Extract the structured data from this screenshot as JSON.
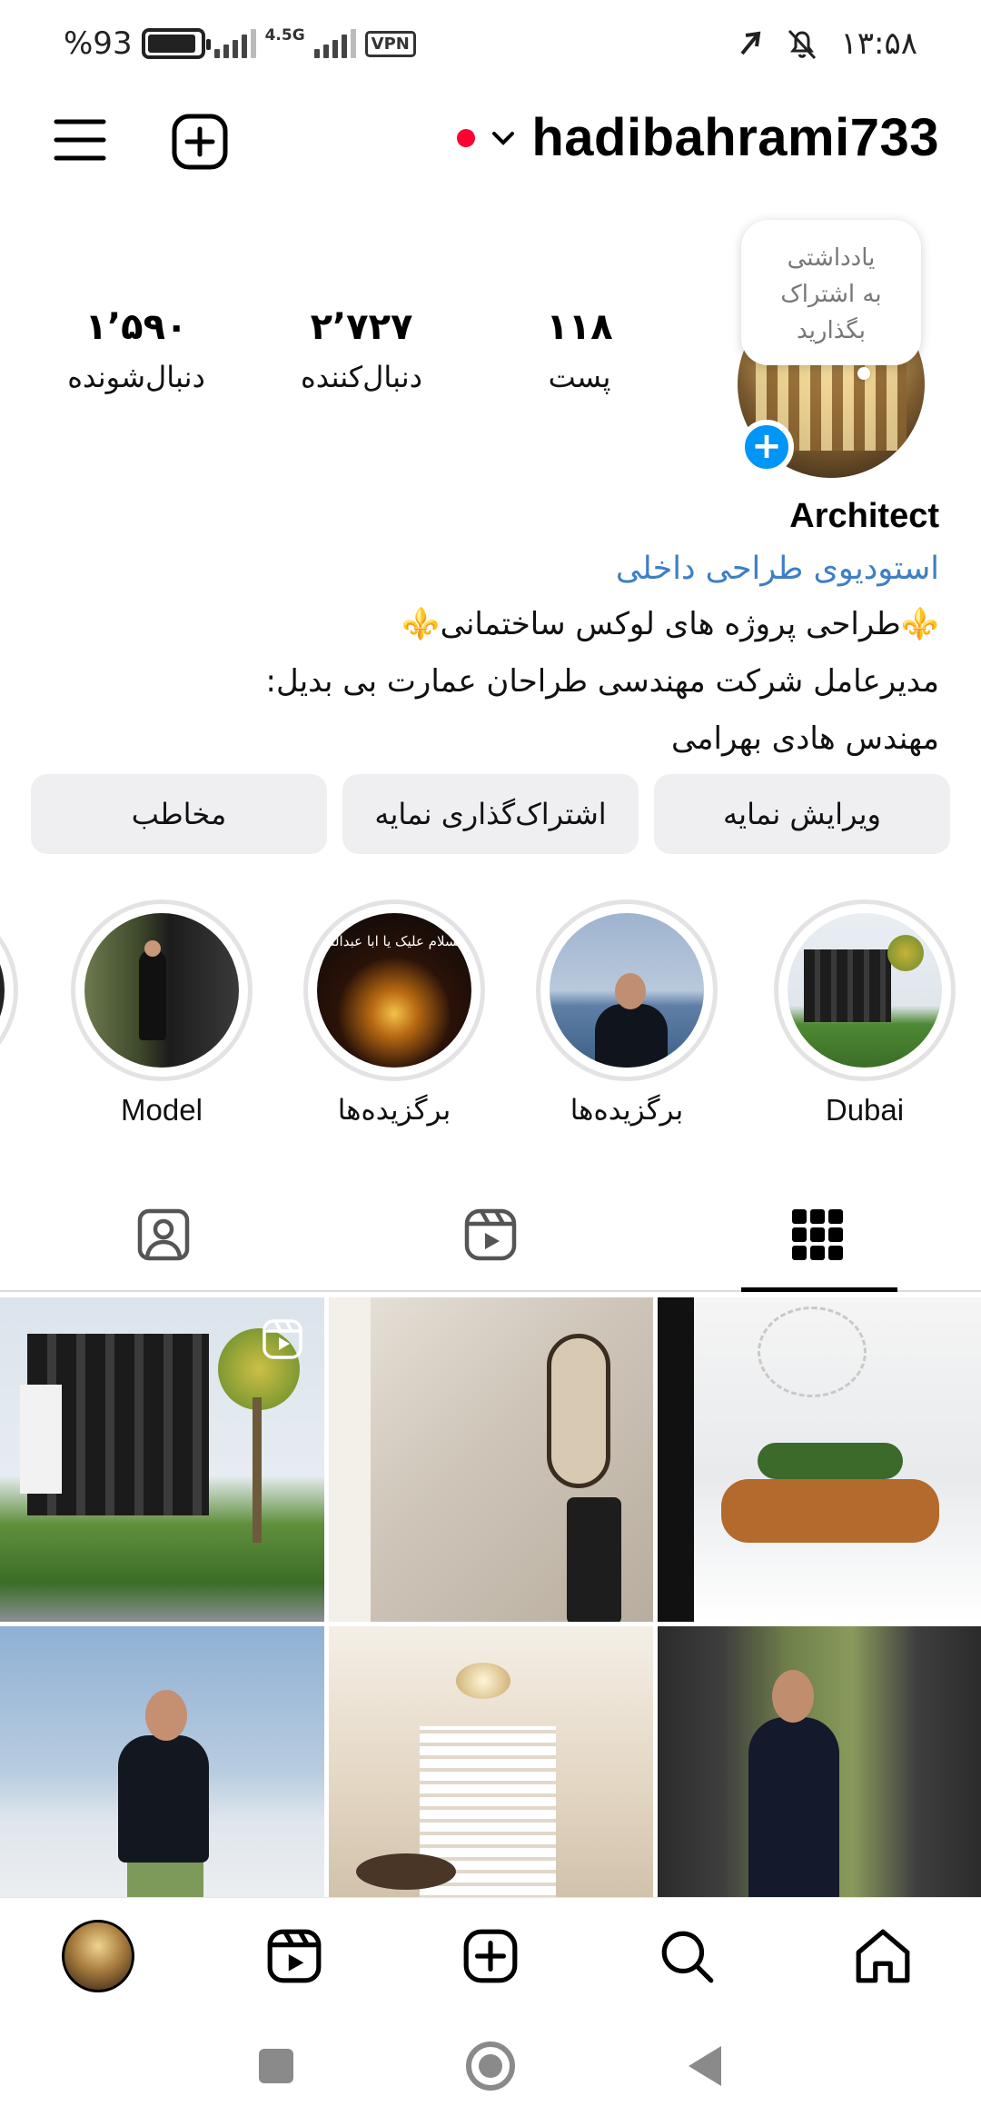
{
  "status_bar": {
    "battery_text": "%93",
    "battery_level": 0.93,
    "network_label": "4.5G",
    "vpn_label": "VPN",
    "time": "۱۳:۵۸"
  },
  "header": {
    "username": "hadibahrami733",
    "menu_icon": "hamburger-menu-icon",
    "add_icon": "plus-square-icon"
  },
  "profile": {
    "note_lines": [
      "یادداشتی",
      "به اشتراک",
      "بگذارید"
    ],
    "stats": [
      {
        "value": "۱’۵۹۰",
        "label": "دنبال‌شونده"
      },
      {
        "value": "۲’۷۲۷",
        "label": "دنبال‌کننده"
      },
      {
        "value": "۱۱۸",
        "label": "پست"
      }
    ]
  },
  "bio": {
    "name": "Architect",
    "category": "استودیوی طراحی داخلی",
    "lines": [
      "⚜️طراحی پروژه های لوکس ساختمانی⚜️",
      "مدیرعامل شرکت مهندسی طراحان عمارت بی بدیل:",
      "مهندس هادی بهرامی"
    ]
  },
  "actions": {
    "edit_profile": "ویرایش نمایه",
    "share_profile": "اشتراک‌گذاری نمایه",
    "contact": "مخاطب"
  },
  "highlights": [
    {
      "label": "Model"
    },
    {
      "label": "برگزیده‌ها"
    },
    {
      "label": "برگزیده‌ها"
    },
    {
      "label": "Dubai"
    }
  ],
  "highlight_banner_text": "السلام علیک یا ابا عبدالله",
  "tabs": {
    "tagged_icon": "tagged-person-icon",
    "reels_icon": "reels-icon",
    "grid_icon": "grid-icon"
  },
  "bottom_nav": {
    "items": [
      "profile-avatar",
      "reels-icon",
      "create-icon",
      "search-icon",
      "home-icon"
    ]
  },
  "colors": {
    "accent_blue": "#0095f6",
    "link_blue": "#3e7fc5",
    "live_red": "#ff0033",
    "button_gray": "#efeff2"
  }
}
